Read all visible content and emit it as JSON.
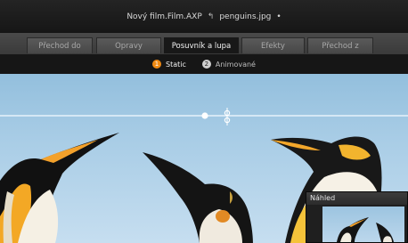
{
  "titlebar": {
    "project": "Nový film.Film.AXP",
    "separator": "↰",
    "file": "penguins.jpg",
    "modified": "•"
  },
  "tabs": [
    {
      "label": "Přechod do",
      "active": false
    },
    {
      "label": "Opravy",
      "active": false
    },
    {
      "label": "Posuvník a lupa",
      "active": true
    },
    {
      "label": "Efekty",
      "active": false
    },
    {
      "label": "Přechod z",
      "active": false
    }
  ],
  "modes": [
    {
      "num": "1",
      "label": "Static",
      "active": true
    },
    {
      "num": "2",
      "label": "Animované",
      "active": false
    }
  ],
  "preview": {
    "title": "Náhled"
  },
  "colors": {
    "accent": "#f08a13",
    "sky": "#a9cde6"
  }
}
